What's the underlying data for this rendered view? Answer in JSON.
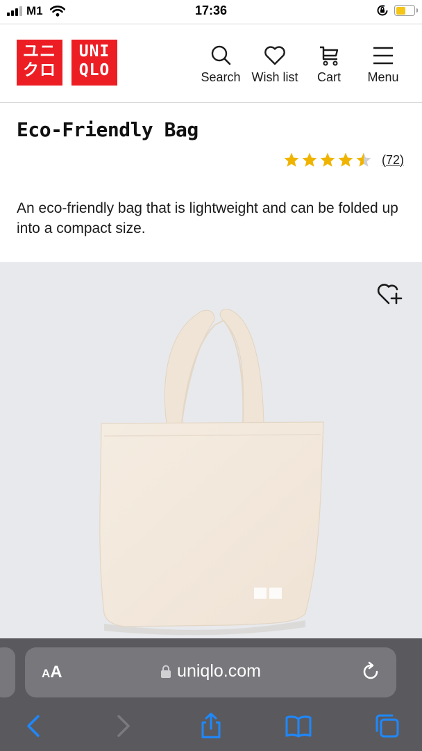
{
  "status_bar": {
    "carrier": "M1",
    "time": "17:36",
    "icons": [
      "signal-icon",
      "wifi-icon",
      "orientation-lock-icon",
      "battery-icon"
    ],
    "battery_level": 0.55,
    "battery_color": "#f5c518"
  },
  "header": {
    "logo": {
      "line1_jp": "ユニ",
      "line2_jp": "クロ",
      "line1": "UNI",
      "line2": "QLO",
      "brand_color": "#ed1d24"
    },
    "nav": [
      {
        "label": "Search",
        "icon": "search-icon"
      },
      {
        "label": "Wish list",
        "icon": "heart-icon"
      },
      {
        "label": "Cart",
        "icon": "cart-icon"
      },
      {
        "label": "Menu",
        "icon": "menu-icon"
      }
    ]
  },
  "product": {
    "title": "Eco-Friendly Bag",
    "rating": 4.5,
    "rating_max": 5,
    "review_count": "(72)",
    "star_color": "#f0b400",
    "description": "An eco-friendly bag that is lightweight and can be folded up into a compact size.",
    "image_background": "#e8e9ec",
    "wish_add_icon": "heart-plus-icon"
  },
  "browser": {
    "text_size_label_small": "A",
    "text_size_label_big": "A",
    "url": "uniqlo.com",
    "accent_color": "#1e88ff",
    "toolbar": [
      "back-icon",
      "forward-icon",
      "share-icon",
      "bookmarks-icon",
      "tabs-icon"
    ]
  }
}
